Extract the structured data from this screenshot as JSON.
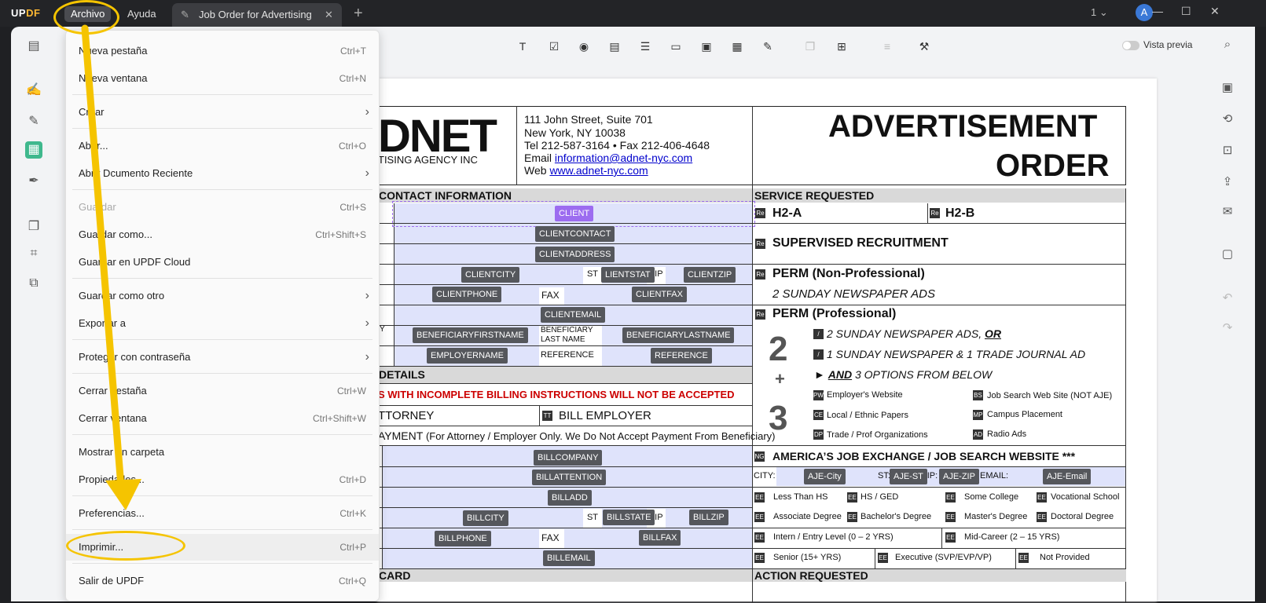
{
  "titlebar": {
    "logo_a": "UP",
    "logo_b": "DF",
    "menu_archivo": "Archivo",
    "menu_ayuda": "Ayuda",
    "tab_title": "Job Order for Advertising",
    "tab_close": "✕",
    "tab_add": "+",
    "page_count": "1",
    "avatar": "A"
  },
  "toolbar": {
    "preview_label": "Vista previa"
  },
  "menu": {
    "items": [
      {
        "label": "Nueva pestaña",
        "shortcut": "Ctrl+T"
      },
      {
        "label": "Nueva ventana",
        "shortcut": "Ctrl+N"
      },
      {
        "label": "Crear",
        "shortcut": ""
      },
      {
        "label": "Abrir...",
        "shortcut": "Ctrl+O"
      },
      {
        "label": "Abrir Dcumento Reciente",
        "shortcut": ""
      },
      {
        "label": "Guardar",
        "shortcut": "Ctrl+S"
      },
      {
        "label": "Guardar como...",
        "shortcut": "Ctrl+Shift+S"
      },
      {
        "label": "Guardar en UPDF Cloud",
        "shortcut": ""
      },
      {
        "label": "Guardar como otro",
        "shortcut": ""
      },
      {
        "label": "Exportar a",
        "shortcut": ""
      },
      {
        "label": "Proteger con contraseña",
        "shortcut": ""
      },
      {
        "label": "Cerrar pestaña",
        "shortcut": "Ctrl+W"
      },
      {
        "label": "Cerrar ventana",
        "shortcut": "Ctrl+Shift+W"
      },
      {
        "label": "Mostrar en carpeta",
        "shortcut": ""
      },
      {
        "label": "Propiedades...",
        "shortcut": "Ctrl+D"
      },
      {
        "label": "Preferencias...",
        "shortcut": "Ctrl+K"
      },
      {
        "label": "Imprimir...",
        "shortcut": "Ctrl+P"
      },
      {
        "label": "Salir de UPDF",
        "shortcut": "Ctrl+Q"
      }
    ]
  },
  "doc": {
    "logo": "DNET",
    "logo_sub": "TISING AGENCY INC",
    "addr1": "111 John Street, Suite 701",
    "addr2": "New York, NY 10038",
    "addr3": "Tel 212-587-3164 • Fax 212-406-4648",
    "email_label": "Email",
    "email": "information@adnet-nyc.com",
    "web_label": "Web",
    "web": "www.adnet-nyc.com",
    "title1": "ADVERTISEMENT",
    "title2": "ORDER",
    "h_contact": "CONTACT INFORMATION",
    "h_service": "SERVICE REQUESTED",
    "h2a": "H2-A",
    "h2b": "H2-B",
    "supervised": "SUPERVISED RECRUITMENT",
    "perm_np": "PERM (Non-Professional)",
    "perm_np_sub": "2 SUNDAY NEWSPAPER ADS",
    "perm_p": "PERM (Professional)",
    "opt1": "2 SUNDAY NEWSPAPER ADS,",
    "opt1_or": "OR",
    "opt2": "1 SUNDAY NEWSPAPER & 1 TRADE JOURNAL AD",
    "opt3_and": "AND",
    "opt3": "3 OPTIONS FROM BELOW",
    "big2": "2",
    "bigplus": "+",
    "big3": "3",
    "o_emp": "Employer's Website",
    "o_job": "Job Search Web Site (NOT AJE)",
    "o_local": "Local / Ethnic Papers",
    "o_campus": "Campus Placement",
    "o_trade": "Trade / Prof Organizations",
    "o_radio": "Radio Ads",
    "h_details": "DETAILS",
    "warn": "S WITH INCOMPLETE BILLING INSTRUCTIONS WILL NOT BE ACCEPTED",
    "attorney": "TTORNEY",
    "bill_emp": "BILL EMPLOYER",
    "payment": "AYMENT",
    "payment_note": "(For Attorney / Employer Only. We Do Not Accept Payment From Beneficiary)",
    "aje": "AMERICA’S JOB EXCHANGE / JOB SEARCH WEBSITE ***",
    "city": "CITY:",
    "st": "ST:",
    "zip": "ZIP:",
    "email_f": "EMAIL:",
    "e1": "Less Than HS",
    "e2": "HS / GED",
    "e3": "Some College",
    "e4": "Vocational School",
    "e5": "Associate Degree",
    "e6": "Bachelor's Degree",
    "e7": "Master's Degree",
    "e8": "Doctoral Degree",
    "x1": "Intern / Entry Level (0 – 2 YRS)",
    "x2": "Mid-Career (2 – 15 YRS)",
    "x3": "Senior (15+ YRS)",
    "x4": "Executive (SVP/EVP/VP)",
    "x5": "Not Provided",
    "h_card": "CARD",
    "h_action": "ACTION REQUESTED",
    "st_lbl": "ST",
    "zip_lbl": "ZIP",
    "fax_lbl": "FAX",
    "benef_last1": "BENEFICIARY",
    "benef_last2": "LAST NAME",
    "reference_lbl": "REFERENCE",
    "y_lbl": "Y",
    "f": {
      "client": "CLIENT",
      "clientcontact": "CLIENTCONTACT",
      "clientaddress": "CLIENTADDRESS",
      "clientcity": "CLIENTCITY",
      "clientstat": "LIENTSTAT",
      "clientzip": "CLIENTZIP",
      "clientphone": "CLIENTPHONE",
      "clientfax": "CLIENTFAX",
      "clientemail": "CLIENTEMAIL",
      "bfirst": "BENEFICIARYFIRSTNAME",
      "blast": "BENEFICIARYLASTNAME",
      "employername": "EMPLOYERNAME",
      "reference": "REFERENCE",
      "billcompany": "BILLCOMPANY",
      "billattention": "BILLATTENTION",
      "billadd": "BILLADD",
      "billcity": "BILLCITY",
      "billstate": "BILLSTATE",
      "billzip": "BILLZIP",
      "billphone": "BILLPHONE",
      "billfax": "BILLFAX",
      "billemail": "BILLEMAIL",
      "ajecity": "AJE-City",
      "ajest": "AJE-ST",
      "ajezip": "AJE-ZIP",
      "ajeemail": "AJE-Email"
    },
    "chk": {
      "re": "Re",
      "pw": "PW",
      "bs": "BS",
      "ce": "CE",
      "mp": "MP",
      "dp": "DP",
      "ad": "AD",
      "tt": "TT",
      "ng": "NG",
      "ee": "EE",
      "slash": "/"
    }
  },
  "colors": {
    "accent": "#9c6cf0",
    "highlight": "#f5c400"
  }
}
